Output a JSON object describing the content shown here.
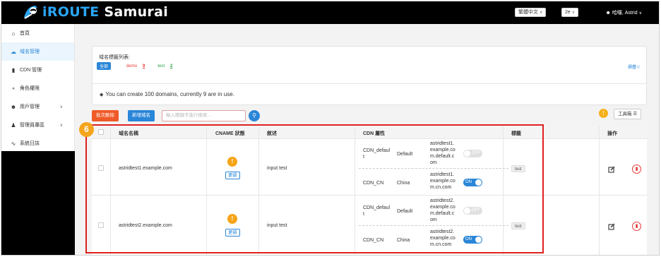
{
  "header": {
    "brand_part1": "iROUTE",
    "brand_part2": "Samurai",
    "language": "繁體中文",
    "version": "2e",
    "user_greeting": "哈囉, Astrid"
  },
  "sidebar": {
    "items": [
      {
        "label": "首頁",
        "icon": "home-icon"
      },
      {
        "label": "域名管理",
        "icon": "cloud-icon"
      },
      {
        "label": "CDN 管理",
        "icon": "file-icon"
      },
      {
        "label": "角色權限",
        "icon": "key-icon"
      },
      {
        "label": "用戶管理",
        "icon": "user-icon"
      },
      {
        "label": "管理員專區",
        "icon": "admin-icon"
      },
      {
        "label": "系統日誌",
        "icon": "log-icon"
      }
    ]
  },
  "domain_labels": {
    "title": "域名標籤列表:",
    "all": "全部",
    "demo_label": "demo",
    "demo_count": "9",
    "test_label": "test",
    "test_count": "2",
    "fold": "摺疊"
  },
  "notice": "You can create 100 domains, currently 9 are in use.",
  "toolbar": {
    "batch_delete": "批次刪除",
    "add_domain": "新增域名",
    "search_placeholder": "輸入關鍵字進行搜索...",
    "toolbox": "工具箱"
  },
  "table": {
    "headers": {
      "domain": "域名名稱",
      "cname": "CNAME 狀態",
      "desc": "敘述",
      "cdn": "CDN 屬性",
      "tags": "標籤",
      "actions": "操作"
    },
    "update_label": "更新",
    "rows": [
      {
        "domain": "astridtest1.example.com",
        "desc": "input test",
        "tag": "test",
        "cdns": [
          {
            "name_l1": "CDN_defaul",
            "name_l2": "t",
            "region": "Default",
            "target_l1": "astridtest1.",
            "target_l2": "example.co",
            "target_l3": "m.default.c",
            "target_l4": "om",
            "toggle": "OFF"
          },
          {
            "name_l1": "CDN_CN",
            "region": "China",
            "target_l1": "astridtest1.",
            "target_l2": "example.co",
            "target_l3": "m.cn.com",
            "toggle": "ON"
          }
        ]
      },
      {
        "domain": "astridtest2.example.com",
        "desc": "input test",
        "tag": "test",
        "cdns": [
          {
            "name_l1": "CDN_defaul",
            "name_l2": "t",
            "region": "Default",
            "target_l1": "astridtest2.",
            "target_l2": "example.co",
            "target_l3": "m.default.c",
            "target_l4": "om",
            "toggle": "OFF"
          },
          {
            "name_l1": "CDN_CN",
            "region": "China",
            "target_l1": "astridtest2.",
            "target_l2": "example.co",
            "target_l3": "m.cn.com",
            "toggle": "ON"
          }
        ]
      }
    ]
  },
  "step_badge": "6",
  "colors": {
    "accent": "#2a86d8",
    "danger": "#f05a28",
    "highlight": "#e02020",
    "badge": "#f4a51c"
  }
}
